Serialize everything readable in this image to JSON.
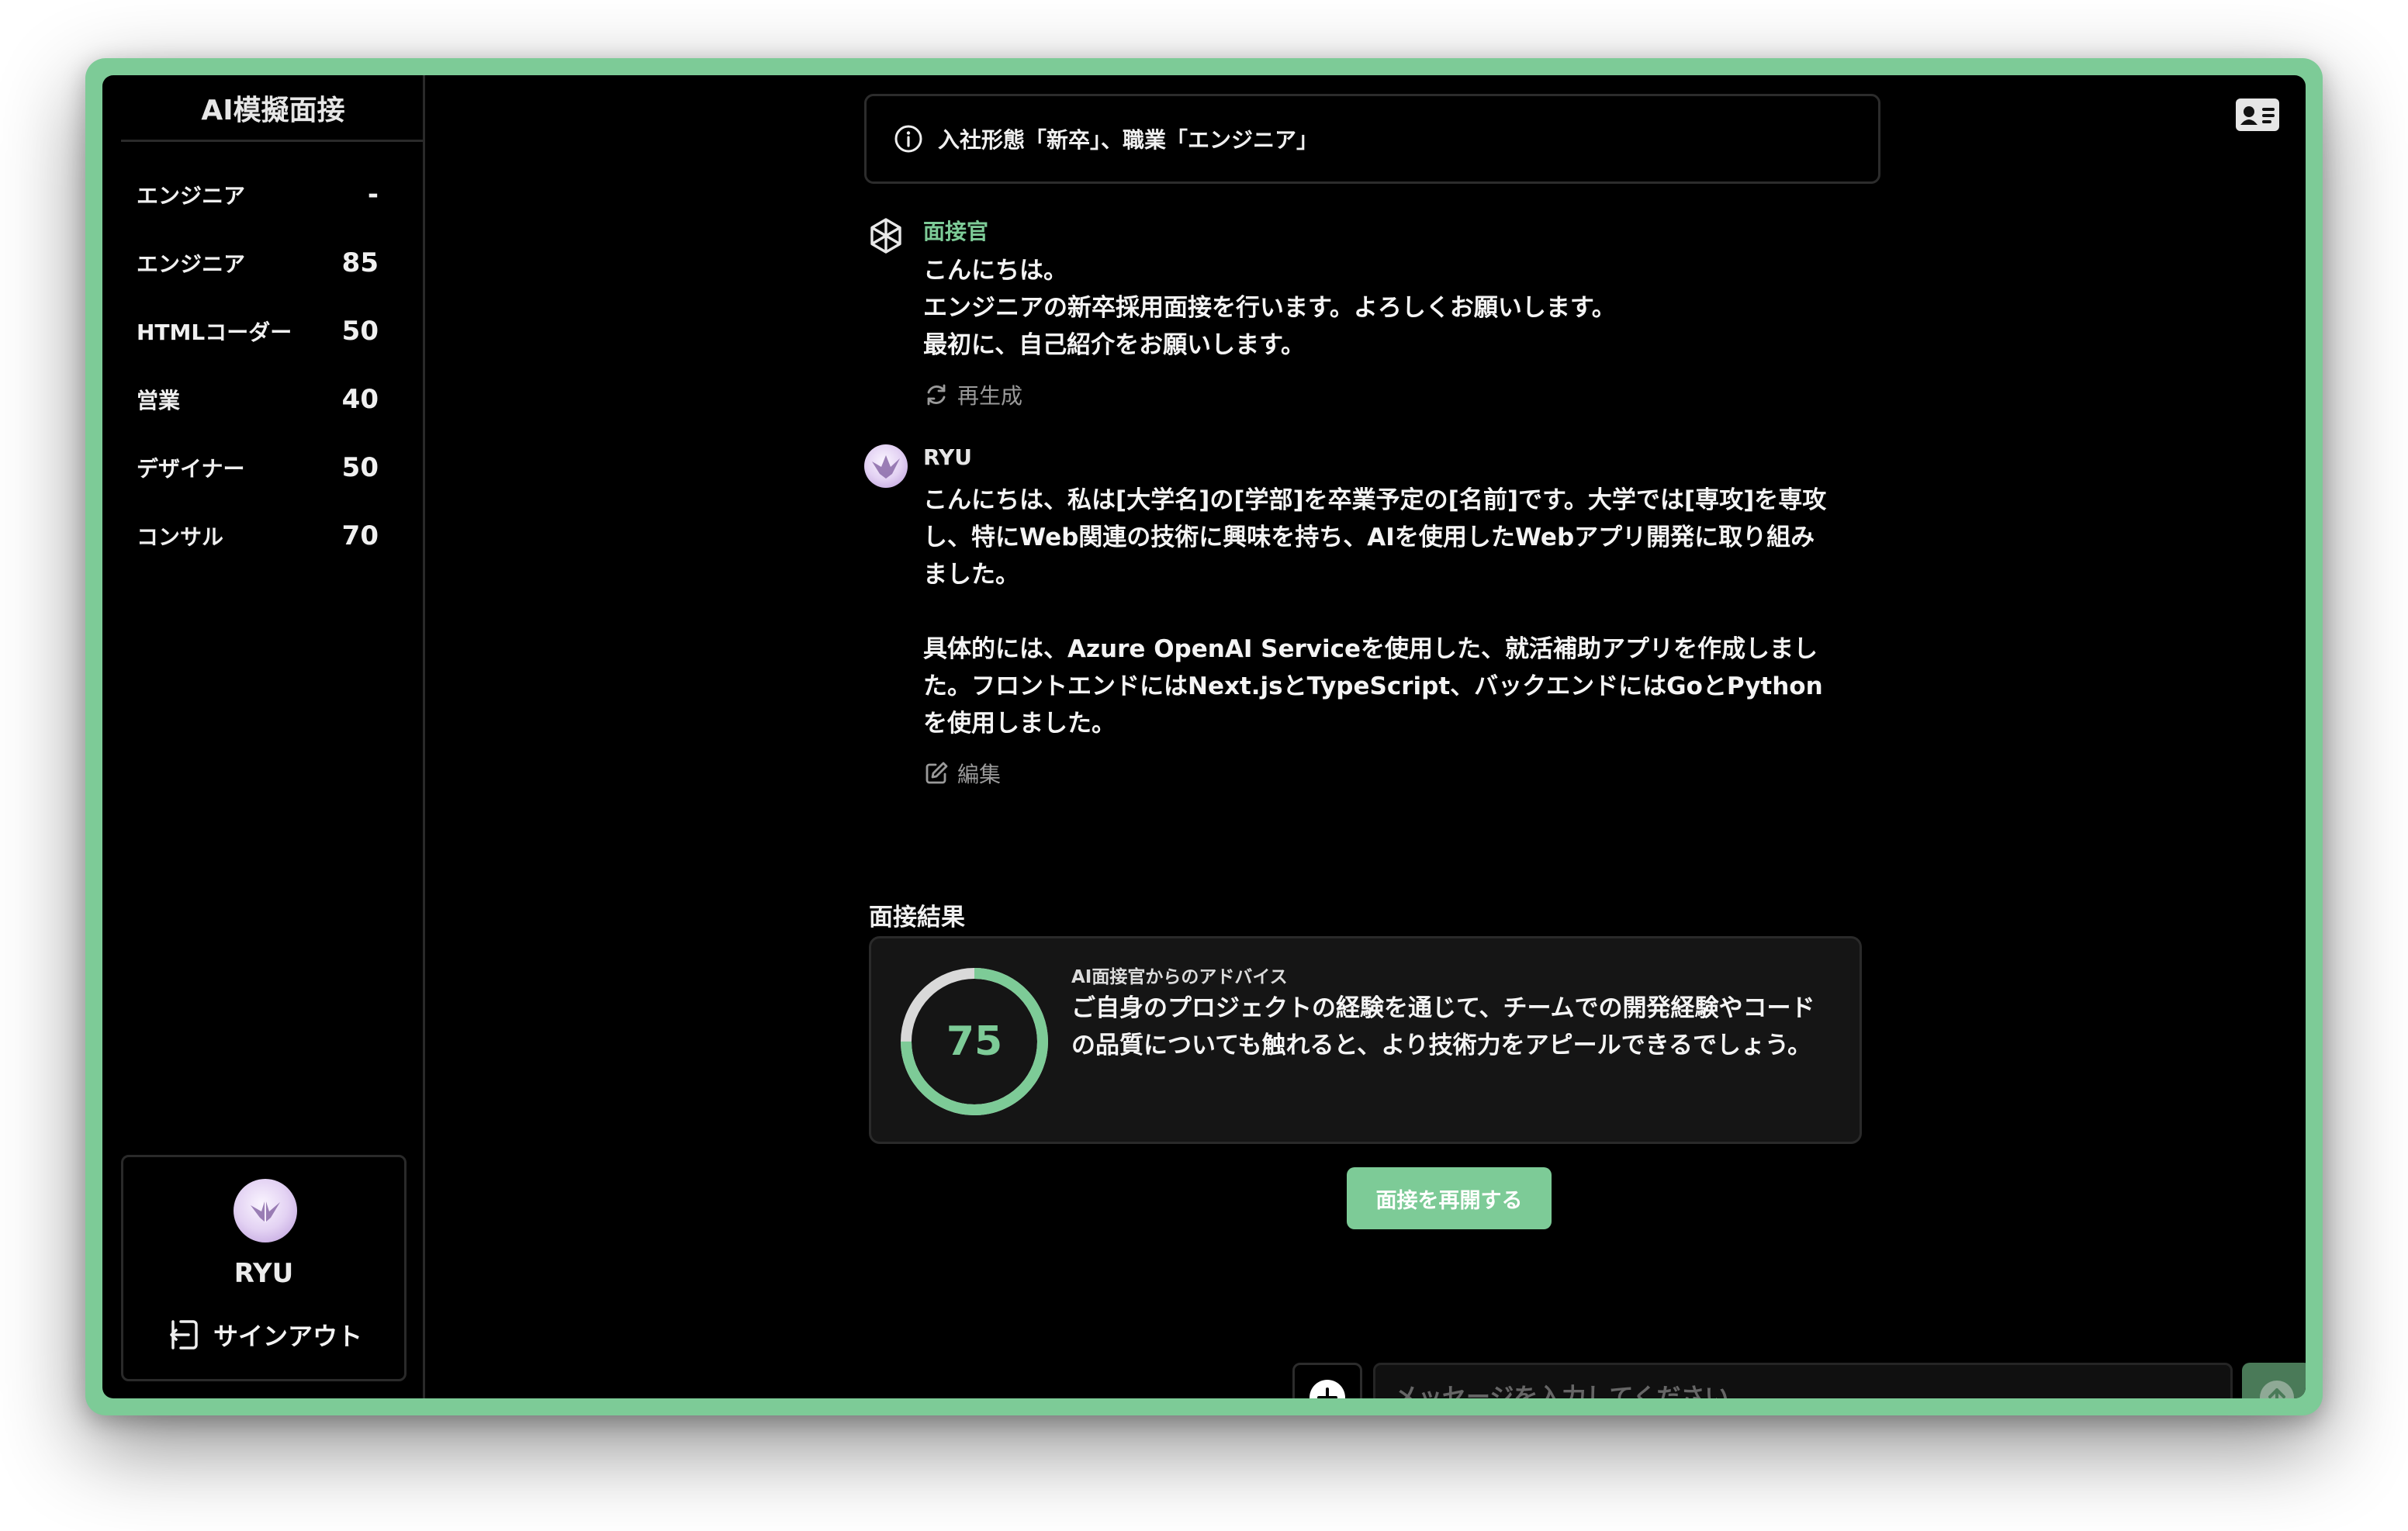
{
  "app": {
    "title": "AI模擬面接",
    "accent_color": "#7dcb97"
  },
  "sidebar": {
    "history": [
      {
        "label": "エンジニア",
        "score": "-"
      },
      {
        "label": "エンジニア",
        "score": "85"
      },
      {
        "label": "HTMLコーダー",
        "score": "50"
      },
      {
        "label": "営業",
        "score": "40"
      },
      {
        "label": "デザイナー",
        "score": "50"
      },
      {
        "label": "コンサル",
        "score": "70"
      }
    ],
    "user": {
      "name": "RYU",
      "signout_label": "サインアウト"
    }
  },
  "header": {
    "info_icon": "info-circle-icon",
    "info_text": "入社形態「新卒」、職業「エンジニア」",
    "profile_icon": "id-card-icon"
  },
  "messages": [
    {
      "sender": "面接官",
      "avatar_icon": "openai-logo-icon",
      "text": "こんにちは。\nエンジニアの新卒採用面接を行います。よろしくお願いします。\n最初に、自己紹介をお願いします。",
      "action_label": "再生成",
      "action_icon": "refresh-icon"
    },
    {
      "sender": "RYU",
      "avatar_icon": "paper-crane-avatar",
      "text": "こんにちは、私は[大学名]の[学部]を卒業予定の[名前]です。大学では[専攻]を専攻\nし、特にWeb関連の技術に興味を持ち、AIを使用したWebアプリ開発に取り組み\nました。\n\n具体的には、Azure OpenAI Serviceを使用した、就活補助アプリを作成しまし\nた。フロントエンドにはNext.jsとTypeScript、バックエンドにはGoとPython\nを使用しました。",
      "action_label": "編集",
      "action_icon": "edit-icon"
    }
  ],
  "result": {
    "title": "面接結果",
    "score": 75,
    "score_max": 100,
    "advice_label": "AI面接官からのアドバイス",
    "advice_text": "ご自身のプロジェクトの経験を通じて、チームでの開発経験やコード\nの品質についても触れると、より技術力をアピールできるでしょう。",
    "restart_label": "面接を再開する"
  },
  "composer": {
    "placeholder": "メッセージを入力してください",
    "value": "",
    "add_icon": "plus-circle-icon",
    "send_icon": "arrow-up-circle-icon"
  }
}
